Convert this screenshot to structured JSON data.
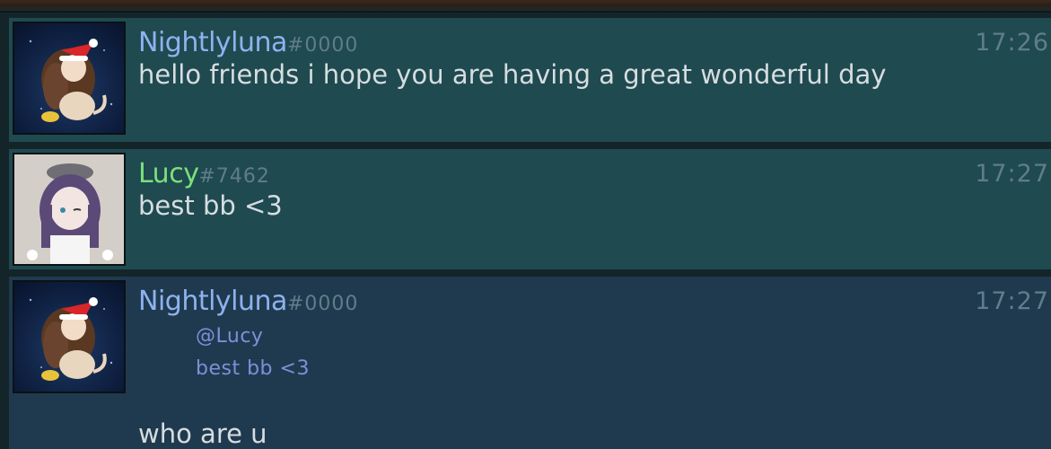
{
  "messages": [
    {
      "username": "Nightlyluna",
      "discriminator": "#0000",
      "time": "17:26",
      "text": "hello friends i hope you are having a great wonderful day",
      "avatar": "santa-hat-character-avatar"
    },
    {
      "username": "Lucy",
      "discriminator": "#7462",
      "time": "17:27",
      "text": "best bb <3",
      "avatar": "purple-hair-girl-avatar"
    },
    {
      "username": "Nightlyluna",
      "discriminator": "#0000",
      "time": "17:27",
      "quote": {
        "user": "@Lucy",
        "text": "best bb <3"
      },
      "text": "who are u",
      "avatar": "santa-hat-character-avatar"
    }
  ],
  "colors": {
    "luna_name": "#8fb2ee",
    "lucy_name": "#7be07b",
    "teal_row": "#1f4a50",
    "blue_row": "#1f3a4f",
    "quote": "#7f8fd8",
    "text": "#d6dde0"
  }
}
